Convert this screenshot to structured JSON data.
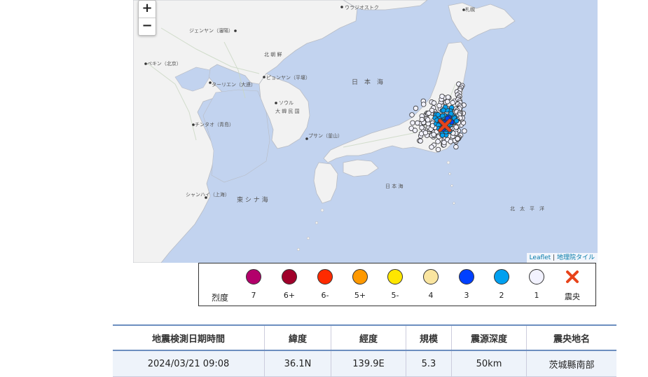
{
  "map": {
    "zoom_in_label": "+",
    "zoom_out_label": "−",
    "attribution_leaflet": "Leaflet",
    "attribution_sep": " | ",
    "attribution_tiles": "地理院タイル",
    "place_labels": [
      "ウラジオストク",
      "ジェンヤン（瀋陽）",
      "北 朝 鮮",
      "ペキン（北京）",
      "ターリエン（大連）",
      "ピョンヤン（平壌）",
      "ソウル",
      "大 韓 民 国",
      "チンタオ（青島）",
      "プサン（釜山）",
      "シャンハイ（上海）",
      "東 シ ナ 海",
      "日　本　海",
      "日 本 海",
      "北　太　平　洋",
      "札幌"
    ],
    "colors": {
      "sea": "#c2d3ef",
      "land": "#f2f2f2"
    },
    "epicenter_icon": "red-x-icon",
    "station_symbols": "intensity-circles"
  },
  "legend": {
    "title": "烈度",
    "items": [
      {
        "label": "7",
        "color": "#b3006b"
      },
      {
        "label": "6+",
        "color": "#a0002a"
      },
      {
        "label": "6-",
        "color": "#ff2a00"
      },
      {
        "label": "5+",
        "color": "#ff9900"
      },
      {
        "label": "5-",
        "color": "#ffe600"
      },
      {
        "label": "4",
        "color": "#fae5a0"
      },
      {
        "label": "3",
        "color": "#0040ff"
      },
      {
        "label": "2",
        "color": "#00a0f0"
      },
      {
        "label": "1",
        "color": "#f2f2ff"
      },
      {
        "label": "震央",
        "color": "#e8431a",
        "icon": "cross-icon"
      }
    ]
  },
  "table": {
    "headers": [
      "地震検測日期時間",
      "緯度",
      "經度",
      "規模",
      "震源深度",
      "震央地名"
    ],
    "row": [
      "2024/03/21 09:08",
      "36.1N",
      "139.9E",
      "5.3",
      "50km",
      "茨城縣南部"
    ]
  }
}
